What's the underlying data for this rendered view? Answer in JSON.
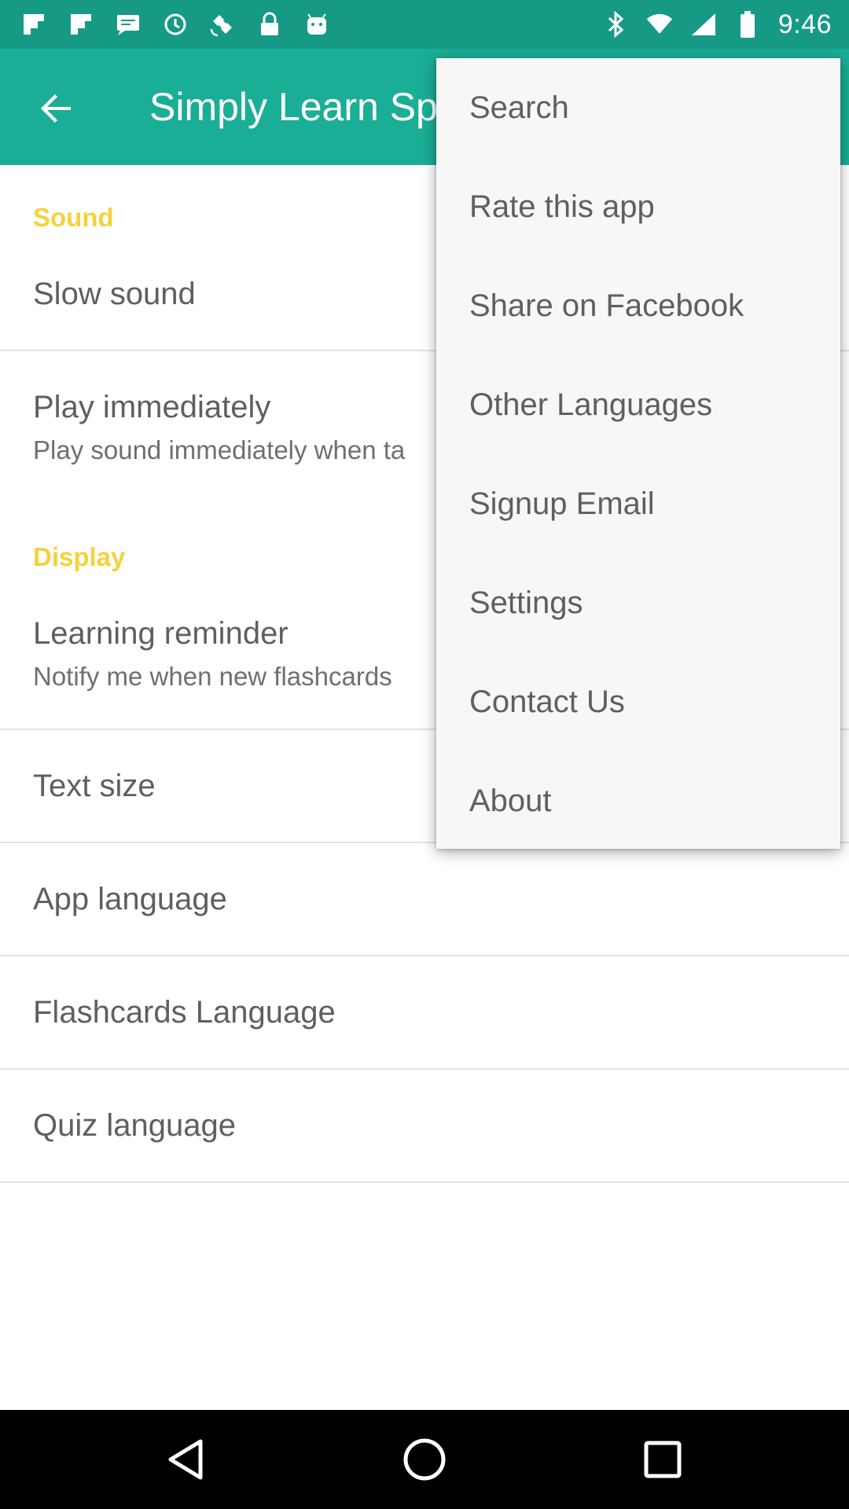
{
  "status_bar": {
    "time": "9:46",
    "left_icons": [
      "flipboard-icon",
      "flipboard-icon",
      "message-icon",
      "alarm-icon",
      "satellite-icon",
      "lock-icon",
      "android-icon"
    ],
    "right_icons": [
      "bluetooth-icon",
      "wifi-icon",
      "signal-icon",
      "battery-icon"
    ]
  },
  "app_bar": {
    "title": "Simply Learn Sp",
    "color": "#1aae96"
  },
  "settings": {
    "sound_header": "Sound",
    "slow_sound": "Slow sound",
    "play_immediately": "Play immediately",
    "play_immediately_sub": "Play sound immediately when ta",
    "display_header": "Display",
    "learning_reminder": "Learning reminder",
    "learning_reminder_sub": "Notify me when new flashcards",
    "text_size": "Text size",
    "app_language": "App language",
    "flashcards_language": "Flashcards Language",
    "quiz_language": "Quiz language",
    "accent_color": "#f5d23a"
  },
  "menu": {
    "items": [
      {
        "label": "Search"
      },
      {
        "label": "Rate this app"
      },
      {
        "label": "Share on Facebook"
      },
      {
        "label": "Other Languages"
      },
      {
        "label": "Signup Email"
      },
      {
        "label": "Settings"
      },
      {
        "label": "Contact Us"
      },
      {
        "label": "About"
      }
    ]
  },
  "nav_bar": {
    "buttons": [
      "back-icon",
      "home-icon",
      "recents-icon"
    ]
  }
}
